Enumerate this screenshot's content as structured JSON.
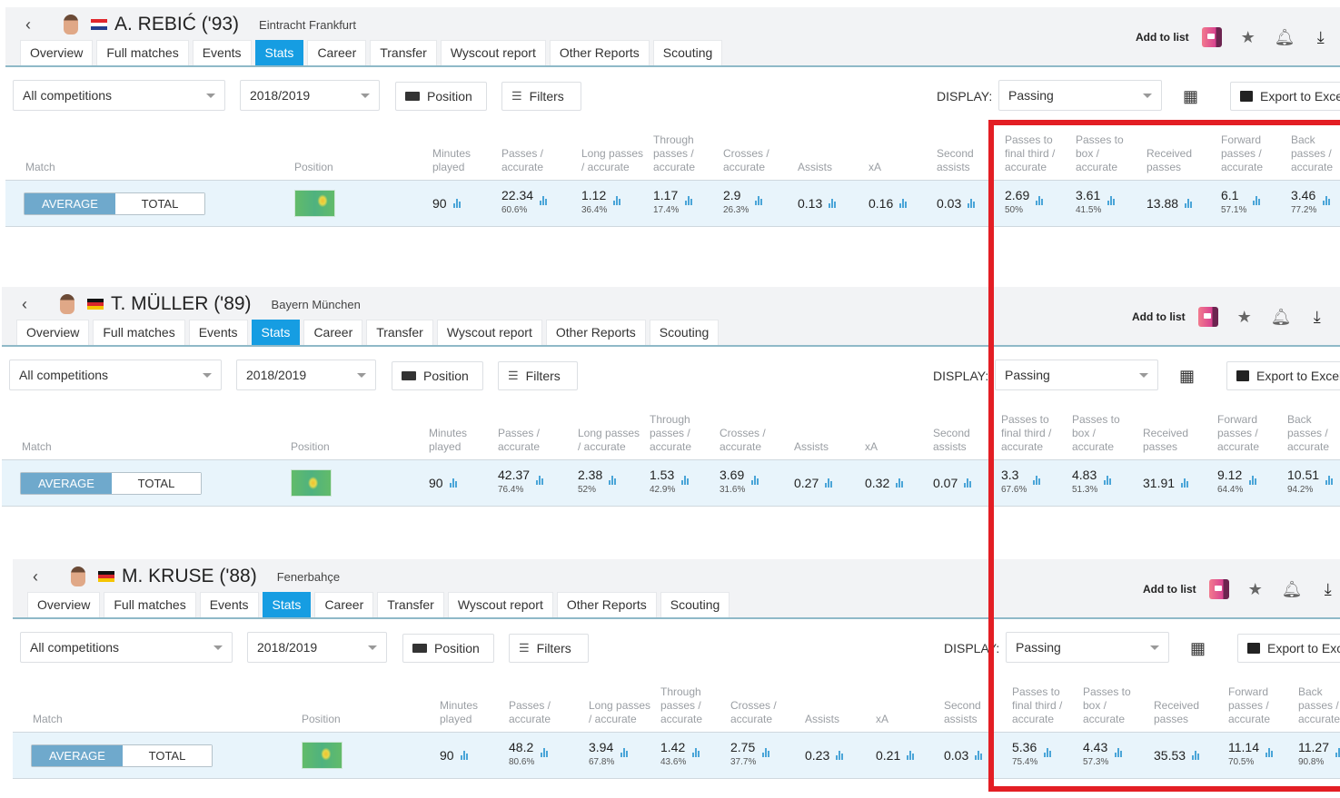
{
  "common": {
    "back_icon": "chevron-left-icon",
    "tabs": [
      "Overview",
      "Full matches",
      "Events",
      "Stats",
      "Career",
      "Transfer",
      "Wyscout report",
      "Other Reports",
      "Scouting"
    ],
    "active_tab": "Stats",
    "add_to_list": "Add to list",
    "competition": "All competitions",
    "season": "2018/2019",
    "position_btn": "Position",
    "filters_btn": "Filters",
    "display_label": "DISPLAY:",
    "display_value": "Passing",
    "export_btn": "Export to Excel",
    "toggle_average": "AVERAGE",
    "toggle_total": "TOTAL",
    "accent": "#169de2",
    "highlight_color": "#e31e24",
    "columns": [
      "Match",
      "Position",
      "Minutes played",
      "Passes / accurate",
      "Long passes / accurate",
      "Through passes / accurate",
      "Crosses / accurate",
      "Assists",
      "xA",
      "Second assists",
      "Passes to final third / accurate",
      "Passes to box / accurate",
      "Received passes",
      "Forward passes / accurate",
      "Back passes / accurate"
    ]
  },
  "players": [
    {
      "name": "A. REBIĆ ('93)",
      "club": "Eintracht Frankfurt",
      "flag": "croatia",
      "stats": {
        "minutes": "90",
        "passes": {
          "v": "22.34",
          "p": "60.6%"
        },
        "long": {
          "v": "1.12",
          "p": "36.4%"
        },
        "through": {
          "v": "1.17",
          "p": "17.4%"
        },
        "crosses": {
          "v": "2.9",
          "p": "26.3%"
        },
        "assists": "0.13",
        "xa": "0.16",
        "second": "0.03",
        "final_third": {
          "v": "2.69",
          "p": "50%"
        },
        "box": {
          "v": "3.61",
          "p": "41.5%"
        },
        "received": "13.88",
        "forward": {
          "v": "6.1",
          "p": "57.1%"
        },
        "back": {
          "v": "3.46",
          "p": "77.2%"
        }
      }
    },
    {
      "name": "T. MÜLLER ('89)",
      "club": "Bayern München",
      "flag": "germany",
      "stats": {
        "minutes": "90",
        "passes": {
          "v": "42.37",
          "p": "76.4%"
        },
        "long": {
          "v": "2.38",
          "p": "52%"
        },
        "through": {
          "v": "1.53",
          "p": "42.9%"
        },
        "crosses": {
          "v": "3.69",
          "p": "31.6%"
        },
        "assists": "0.27",
        "xa": "0.32",
        "second": "0.07",
        "final_third": {
          "v": "3.3",
          "p": "67.6%"
        },
        "box": {
          "v": "4.83",
          "p": "51.3%"
        },
        "received": "31.91",
        "forward": {
          "v": "9.12",
          "p": "64.4%"
        },
        "back": {
          "v": "10.51",
          "p": "94.2%"
        }
      }
    },
    {
      "name": "M. KRUSE ('88)",
      "club": "Fenerbahçe",
      "flag": "germany",
      "stats": {
        "minutes": "90",
        "passes": {
          "v": "48.2",
          "p": "80.6%"
        },
        "long": {
          "v": "3.94",
          "p": "67.8%"
        },
        "through": {
          "v": "1.42",
          "p": "43.6%"
        },
        "crosses": {
          "v": "2.75",
          "p": "37.7%"
        },
        "assists": "0.23",
        "xa": "0.21",
        "second": "0.03",
        "final_third": {
          "v": "5.36",
          "p": "75.4%"
        },
        "box": {
          "v": "4.43",
          "p": "57.3%"
        },
        "received": "35.53",
        "forward": {
          "v": "11.14",
          "p": "70.5%"
        },
        "back": {
          "v": "11.27",
          "p": "90.8%"
        }
      }
    }
  ]
}
